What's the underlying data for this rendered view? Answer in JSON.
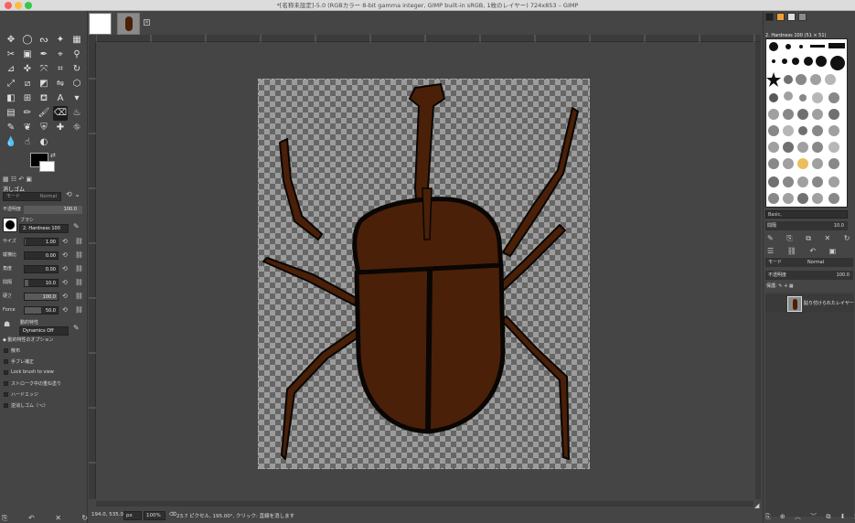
{
  "window": {
    "title": "*[名称未設定]-5.0 (RGBカラー 8-bit gamma integer, GIMP built-in sRGB, 1枚のレイヤー) 724x853 – GIMP"
  },
  "tool_options": {
    "title": "消しゴム",
    "mode_label": "モード",
    "mode_value": "Normal",
    "opacity_label": "不透明度",
    "opacity_value": "100.0",
    "brush_label": "ブラシ",
    "brush_value": "2. Hardness 100",
    "size_label": "サイズ",
    "size_value": "1.00",
    "aspect_label": "縦横比",
    "aspect_value": "0.00",
    "angle_label": "角度",
    "angle_value": "0.00",
    "spacing_label": "間隔",
    "spacing_value": "10.0",
    "hardness_label": "硬さ",
    "hardness_value": "100.0",
    "force_label": "Force",
    "force_value": "50.0",
    "dynamics_label": "動的特性",
    "dynamics_value": "Dynamics Off",
    "dynamics_options_label": "動的特性のオプション",
    "checkboxes": [
      "散布",
      "手ブレ補正",
      "Lock brush to view",
      "ストローク中の重ね塗り",
      "ハードエッジ",
      "逆消しゴム（⌥）"
    ]
  },
  "status": {
    "coords": "194.0, 535.0",
    "unit": "px",
    "zoom": "100%",
    "message": "23.7 ピクセル, 195.00°, クリック: 直線を消します"
  },
  "brushes": {
    "title": "2. Hardness 100 (51 × 51)",
    "filter": "Basic,",
    "spacing_label": "間隔",
    "spacing_value": "10.0"
  },
  "layers": {
    "mode_label": "モード",
    "mode_value": "Normal",
    "opacity_label": "不透明度",
    "opacity_value": "100.0",
    "lock_label": "保護:",
    "layer_name": "貼り付けられたレイヤー"
  },
  "colors": {
    "beetle_body": "#4a2008",
    "beetle_outline": "#0a0604"
  }
}
